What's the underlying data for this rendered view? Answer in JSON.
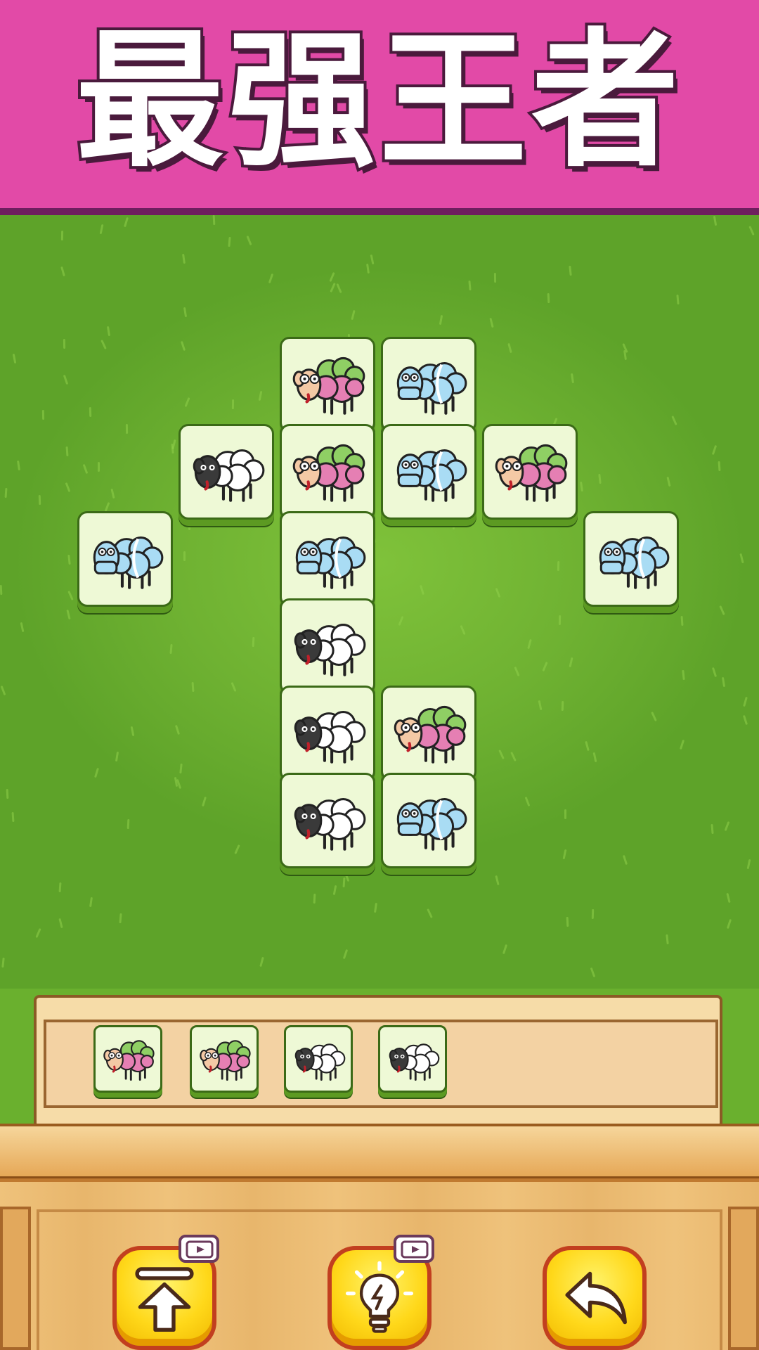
{
  "banner": {
    "title": "最强王者",
    "color": "#e24aa7"
  },
  "board": {
    "tiles": [
      {
        "id": "r0c1",
        "sheep": "pink-sheep"
      },
      {
        "id": "r0c2",
        "sheep": "blue-sheep"
      },
      {
        "id": "r1c0",
        "sheep": "white-sheep"
      },
      {
        "id": "r1c1",
        "sheep": "pink-sheep"
      },
      {
        "id": "r1c2",
        "sheep": "blue-sheep"
      },
      {
        "id": "r1c3",
        "sheep": "pink-sheep"
      },
      {
        "id": "r2-left",
        "sheep": "blue-sheep"
      },
      {
        "id": "r2c1",
        "sheep": "blue-sheep"
      },
      {
        "id": "r2-right",
        "sheep": "blue-sheep"
      },
      {
        "id": "r3c1",
        "sheep": "white-sheep"
      },
      {
        "id": "r4c1",
        "sheep": "white-sheep"
      },
      {
        "id": "r4c2",
        "sheep": "pink-sheep"
      },
      {
        "id": "r5c1",
        "sheep": "white-sheep"
      },
      {
        "id": "r5c2",
        "sheep": "blue-sheep"
      }
    ]
  },
  "tray": {
    "capacity_hint": "7 slots",
    "tiles": [
      {
        "sheep": "pink-sheep"
      },
      {
        "sheep": "pink-sheep"
      },
      {
        "sheep": "white-sheep"
      },
      {
        "sheep": "white-sheep"
      }
    ]
  },
  "buttons": {
    "move_out": {
      "icon": "move-up-icon",
      "ad_badge": "video-ad-icon"
    },
    "hint": {
      "icon": "lightbulb-icon",
      "ad_badge": "video-ad-icon"
    },
    "undo": {
      "icon": "undo-arrow-icon"
    }
  },
  "colors": {
    "grass": "#6fb232",
    "tile_face": "#eef9d6",
    "button_yellow": "#ffd81a",
    "button_border": "#c23f1f",
    "wood": "#efc27b"
  }
}
